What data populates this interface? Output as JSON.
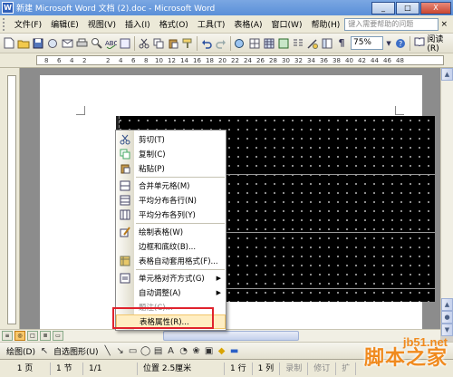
{
  "window": {
    "title": "新建 Microsoft Word 文档 (2).doc - Microsoft Word",
    "app_icon": "W",
    "controls": [
      "_",
      "□",
      "X"
    ]
  },
  "menubar": {
    "items": [
      "文件(F)",
      "编辑(E)",
      "视图(V)",
      "插入(I)",
      "格式(O)",
      "工具(T)",
      "表格(A)",
      "窗口(W)",
      "帮助(H)"
    ],
    "help_placeholder": "键入需要帮助的问题",
    "close": "×"
  },
  "toolbar": {
    "zoom": "75%",
    "read_label": "阅读(R)"
  },
  "ruler": {
    "labels": [
      "8",
      "6",
      "4",
      "2",
      "2",
      "4",
      "6",
      "8",
      "10",
      "12",
      "14",
      "16",
      "18",
      "20",
      "22",
      "24",
      "26",
      "28",
      "30",
      "32",
      "34",
      "36",
      "38",
      "40",
      "42",
      "44",
      "46",
      "48"
    ]
  },
  "context_menu": {
    "items": [
      {
        "label": "剪切(T)",
        "icon": "scissors-icon"
      },
      {
        "label": "复制(C)",
        "icon": "copy-icon"
      },
      {
        "label": "粘贴(P)",
        "icon": "paste-icon"
      },
      {
        "label": "合并单元格(M)",
        "icon": "merge-cells-icon"
      },
      {
        "label": "平均分布各行(N)",
        "icon": "distribute-rows-icon"
      },
      {
        "label": "平均分布各列(Y)",
        "icon": "distribute-columns-icon"
      },
      {
        "label": "绘制表格(W)",
        "icon": "draw-table-icon"
      },
      {
        "label": "边框和底纹(B)...",
        "icon": ""
      },
      {
        "label": "表格自动套用格式(F)...",
        "icon": "autoformat-icon"
      },
      {
        "label": "单元格对齐方式(G)",
        "icon": "cell-align-icon"
      },
      {
        "label": "自动调整(A)",
        "icon": ""
      },
      {
        "label": "题注(C)...",
        "icon": ""
      },
      {
        "label": "表格属性(R)...",
        "icon": ""
      }
    ]
  },
  "drawing_toolbar": {
    "draw_label": "绘图(D)",
    "autoshape_label": "自选图形(U)"
  },
  "statusbar": {
    "page": "1 页",
    "section": "1 节",
    "page_of": "1/1",
    "position": "位置 2.5厘米",
    "line": "1 行",
    "column": "1 列",
    "rec": "录制",
    "trk": "修订",
    "ext": "扩"
  },
  "watermark": {
    "url": "jb51.net",
    "name": "脚本之家"
  }
}
